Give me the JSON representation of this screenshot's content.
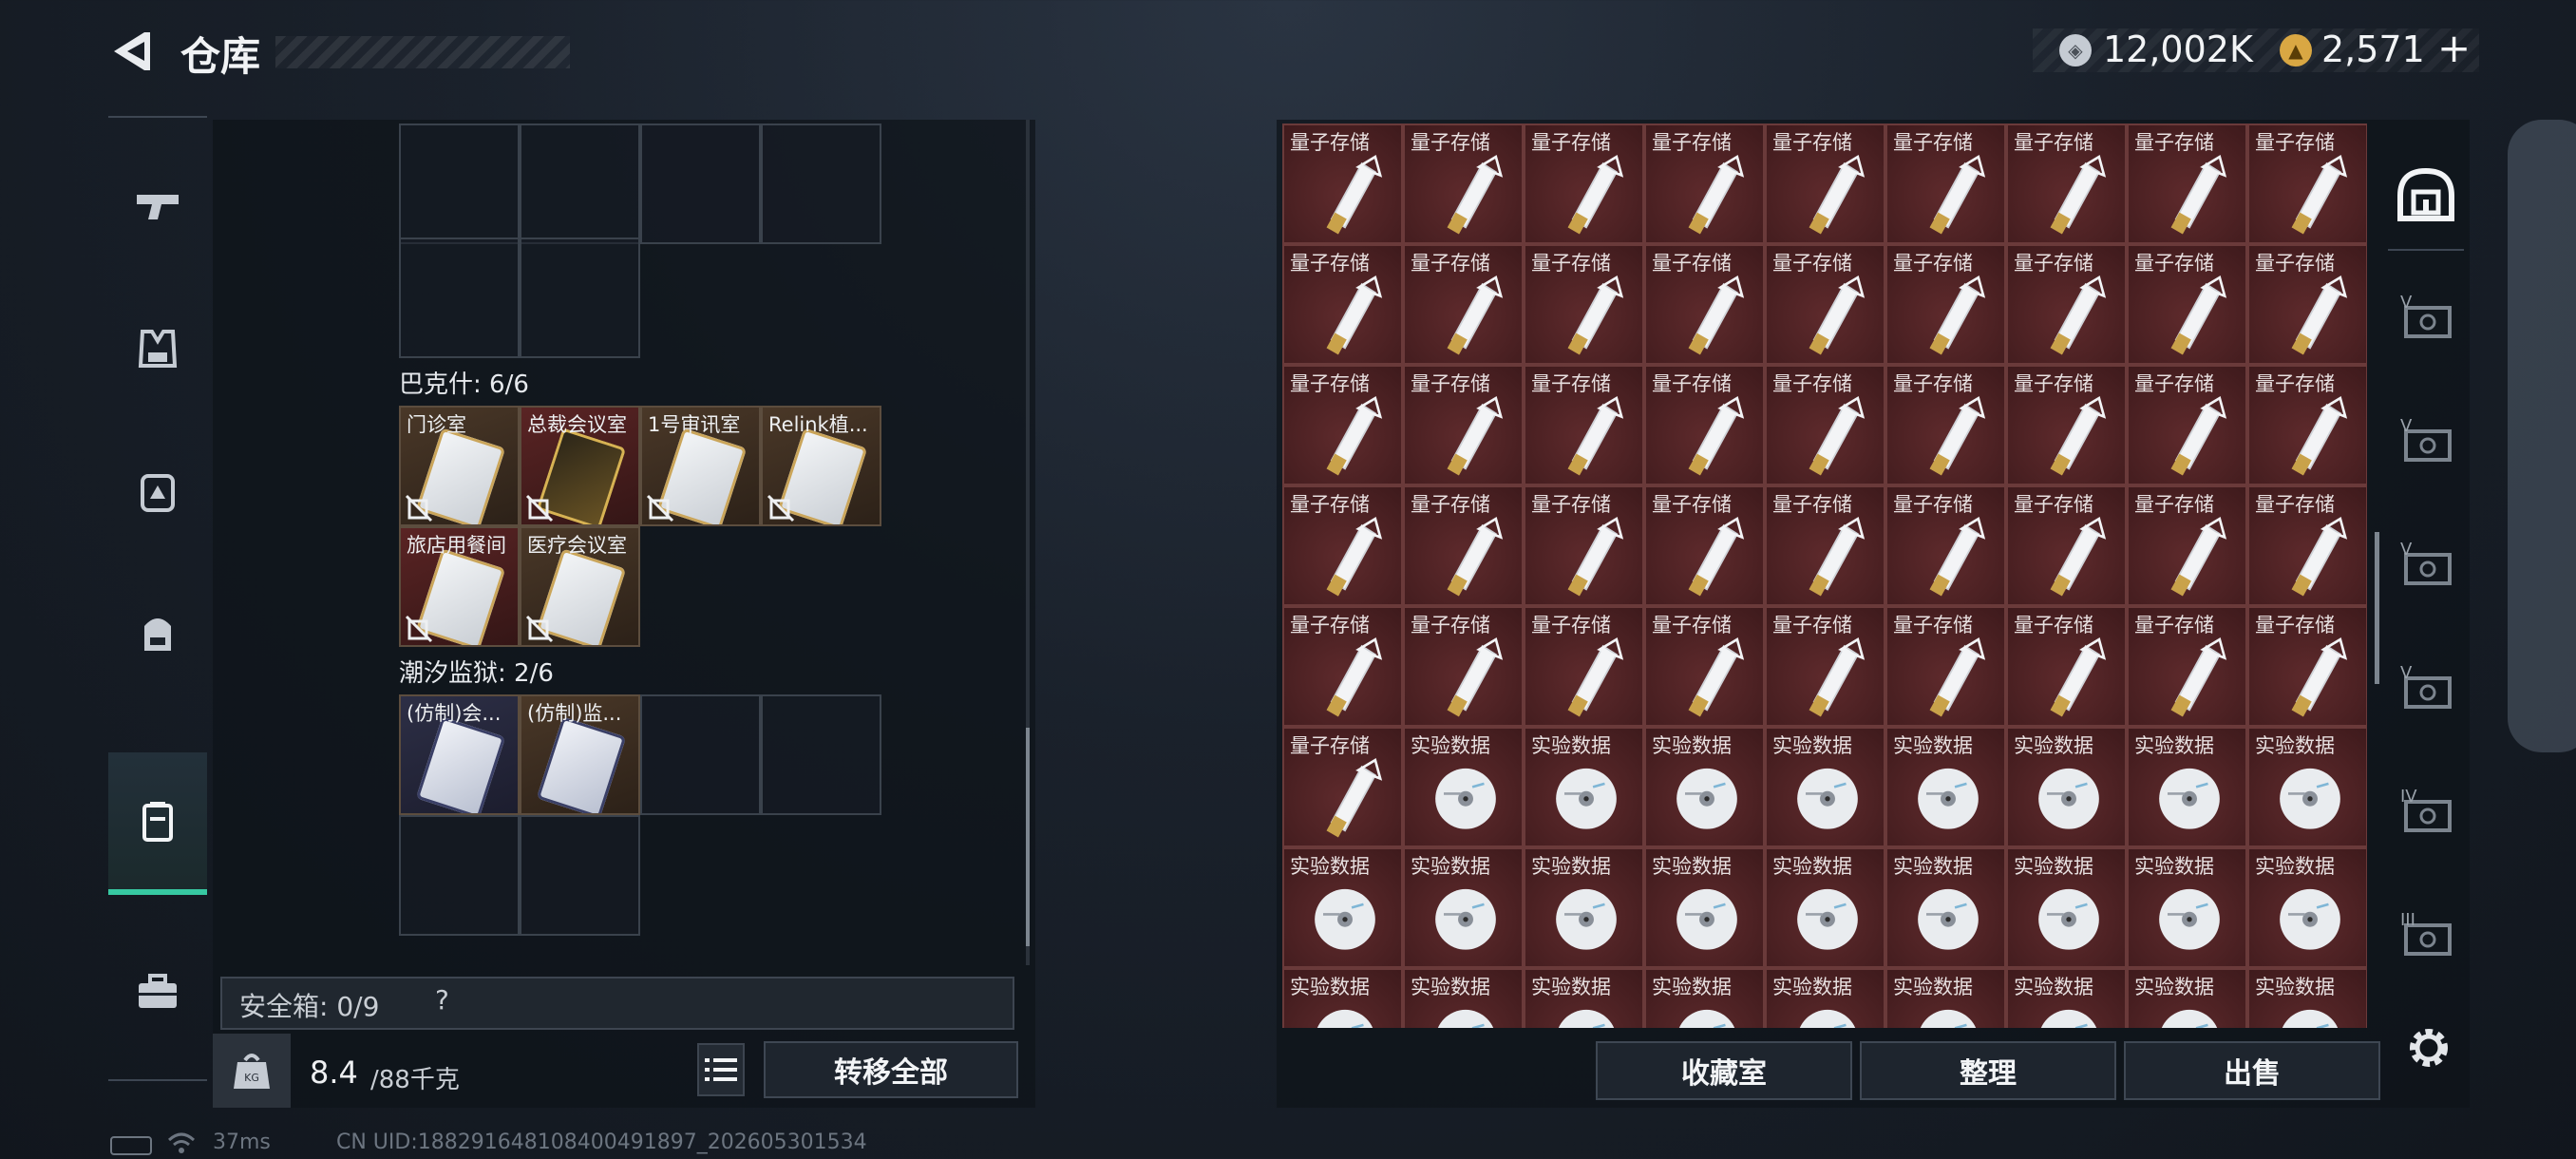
{
  "header": {
    "title": "仓库"
  },
  "currency": {
    "silver": "12,002K",
    "gold": "2,571",
    "plus": "+"
  },
  "left_sidebar": {
    "icons": [
      "pistol-icon",
      "vest-icon",
      "chest-rig-icon",
      "backpack-icon",
      "key-case-icon",
      "toolbox-icon"
    ]
  },
  "sections": [
    {
      "label": "巴克什: 6/6",
      "items": [
        {
          "name": "门诊室",
          "bg": "brown",
          "card": "silver"
        },
        {
          "name": "总裁会议室",
          "bg": "red",
          "card": "gold"
        },
        {
          "name": "1号审讯室",
          "bg": "brown",
          "card": "silver"
        },
        {
          "name": "Relink植...",
          "bg": "brown",
          "card": "silver"
        },
        {
          "name": "旅店用餐间",
          "bg": "red",
          "card": "silver"
        },
        {
          "name": "医疗会议室",
          "bg": "brown",
          "card": "silver"
        }
      ]
    },
    {
      "label": "潮汐监狱: 2/6",
      "items": [
        {
          "name": "(仿制)会...",
          "bg": "blue",
          "card": "ink"
        },
        {
          "name": "(仿制)监...",
          "bg": "brown",
          "card": "ink"
        }
      ]
    }
  ],
  "safebox": {
    "label": "安全箱: 0/9",
    "help": "?"
  },
  "weight": {
    "current": "8.4",
    "max": "/88千克"
  },
  "left_actions": {
    "transfer_all": "转移全部"
  },
  "storage": {
    "quantum": "量子存储",
    "data": "实验数据",
    "grid": [
      [
        "q",
        "q",
        "q",
        "q",
        "q",
        "q",
        "q",
        "q",
        "q"
      ],
      [
        "q",
        "q",
        "q",
        "q",
        "q",
        "q",
        "q",
        "q",
        "q"
      ],
      [
        "q",
        "q",
        "q",
        "q",
        "q",
        "q",
        "q",
        "q",
        "q"
      ],
      [
        "q",
        "q",
        "q",
        "q",
        "q",
        "q",
        "q",
        "q",
        "q"
      ],
      [
        "q",
        "q",
        "q",
        "q",
        "q",
        "q",
        "q",
        "q",
        "q"
      ],
      [
        "q",
        "d",
        "d",
        "d",
        "d",
        "d",
        "d",
        "d",
        "d"
      ],
      [
        "d",
        "d",
        "d",
        "d",
        "d",
        "d",
        "d",
        "d",
        "d"
      ],
      [
        "d",
        "d",
        "d",
        "d",
        "d",
        "d",
        "d",
        "d",
        "d"
      ]
    ]
  },
  "right_sidebar": {
    "tabs": [
      {
        "icon": "home-icon",
        "label": ""
      },
      {
        "icon": "case-icon",
        "label": "V"
      },
      {
        "icon": "case-icon",
        "label": "V"
      },
      {
        "icon": "case-icon",
        "label": "V"
      },
      {
        "icon": "case-icon",
        "label": "V"
      },
      {
        "icon": "case-icon",
        "label": "IV"
      },
      {
        "icon": "case-icon",
        "label": "III"
      }
    ]
  },
  "bottom_actions": {
    "collection": "收藏室",
    "tidy": "整理",
    "sell": "出售"
  },
  "status": {
    "ping": "37ms",
    "uid": "CN UID:18829164810840049​1897_202605301534"
  }
}
